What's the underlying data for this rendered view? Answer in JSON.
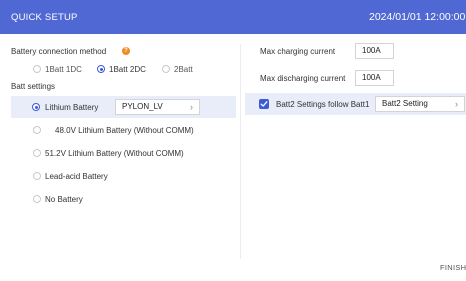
{
  "header": {
    "title": "QUICK SETUP",
    "datetime": "2024/01/01 12:00:00"
  },
  "left": {
    "battery_connection_label": "Battery connection method",
    "connection_options": [
      "1Batt 1DC",
      "1Batt 2DC",
      "2Batt"
    ],
    "connection_selected": "1Batt 2DC",
    "batt_settings_label": "Batt settings",
    "battery_types": [
      "Lithium Battery",
      "48.0V Lithium Battery (Without COMM)",
      "51.2V Lithium Battery (Without COMM)",
      "Lead-acid Battery",
      "No Battery"
    ],
    "battery_selected": "Lithium Battery",
    "lithium_protocol": "PYLON_LV"
  },
  "right": {
    "max_charging_label": "Max charging current",
    "max_charging_value": "100A",
    "max_discharging_label": "Max discharging current",
    "max_discharging_value": "100A",
    "batt2_follow_label": "Batt2 Settings follow Batt1",
    "batt2_follow_checked": true,
    "batt2_setting_label": "Batt2 Setting"
  },
  "footer": {
    "finish_label": "FINISH"
  },
  "colors": {
    "header_bg": "#4f68d4",
    "accent": "#3b5bd6",
    "help_icon": "#f08a24",
    "row_highlight": "#e8edf9"
  },
  "icons": {
    "help": "help-icon",
    "chevron": "chevron-right-icon",
    "check": "checkmark-icon"
  }
}
